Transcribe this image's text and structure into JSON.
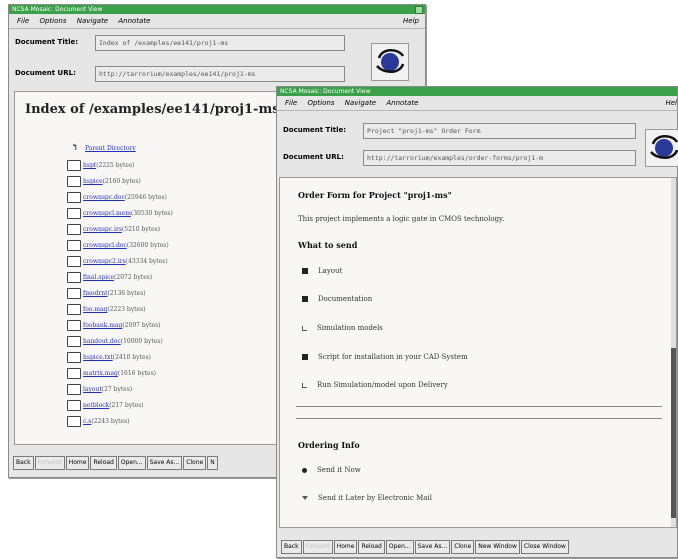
{
  "win1": {
    "title": "NCSA Mosaic: Document View",
    "menu": [
      "File",
      "Options",
      "Navigate",
      "Annotate"
    ],
    "help": "Help",
    "doc_title_label": "Document Title:",
    "doc_title_value": "Index of /examples/ee141/proj1-ms",
    "doc_url_label": "Document URL:",
    "doc_url_value": "http://tarrorium/examples/ee141/proj1-ms",
    "page_heading": "Index of /examples/ee141/proj1-ms",
    "files": [
      {
        "name": "Parent Directory",
        "size": ""
      },
      {
        "name": "hspt",
        "size": "(2225 bytes)"
      },
      {
        "name": "hspice",
        "size": "(2160 bytes)"
      },
      {
        "name": "crownspc.doc",
        "size": "(25946 bytes)"
      },
      {
        "name": "crownspcl.mem",
        "size": "(30530 bytes)"
      },
      {
        "name": "crownspc.irs",
        "size": "(5210 bytes)"
      },
      {
        "name": "crownspcl.doc",
        "size": "(32600 bytes)"
      },
      {
        "name": "crownspc2.irs",
        "size": "(43334 bytes)"
      },
      {
        "name": "final.spice",
        "size": "(2072 bytes)"
      },
      {
        "name": "fmodrnt",
        "size": "(2136 bytes)"
      },
      {
        "name": "foo.mag",
        "size": "(2223 bytes)"
      },
      {
        "name": "foobank.mag",
        "size": "(2097 bytes)"
      },
      {
        "name": "handout.doc",
        "size": "(10000 bytes)"
      },
      {
        "name": "hspice.txt",
        "size": "(2410 bytes)"
      },
      {
        "name": "matrix.mag",
        "size": "(1616 bytes)"
      },
      {
        "name": "layout",
        "size": "(27 bytes)"
      },
      {
        "name": "netblock",
        "size": "(217 bytes)"
      },
      {
        "name": "c.s",
        "size": "(2243 bytes)"
      }
    ],
    "buttons": [
      "Back",
      "Forward",
      "Home",
      "Reload",
      "Open...",
      "Save As...",
      "Clone",
      "N"
    ]
  },
  "win2": {
    "title": "NCSA Mosaic: Document View",
    "menu": [
      "File",
      "Options",
      "Navigate",
      "Annotate"
    ],
    "help": "Hel",
    "doc_title_label": "Document Title:",
    "doc_title_value": "Project \"proj1-ms\" Order Form",
    "doc_url_label": "Document URL:",
    "doc_url_value": "http://tarrorium/examples/order-forms/proj1-m",
    "form_heading": "Order Form for Project \"proj1-ms\"",
    "intro": "This project implements a logic gate in CMOS technology.",
    "what_heading": "What to send",
    "items": [
      {
        "label": "Layout",
        "checked": true
      },
      {
        "label": "Documentation",
        "checked": true
      },
      {
        "label": "Simulation models",
        "checked": false
      },
      {
        "label": "Script for installation in your CAD System",
        "checked": true
      },
      {
        "label": "Run Simulation/model upon Delivery",
        "checked": false
      }
    ],
    "ordering_heading": "Ordering Info",
    "ordering_options": [
      {
        "label": "Send it Now",
        "selected": true
      },
      {
        "label": "Send it Later by Electronic Mail",
        "selected": false
      }
    ],
    "buttons": [
      "Back",
      "Forward",
      "Home",
      "Reload",
      "Open...",
      "Save As...",
      "Clone",
      "New Window",
      "Close Window"
    ]
  },
  "colors": {
    "titlebar": "#3aa04a",
    "link": "#2233bb",
    "content_bg": "#f9f6f6"
  },
  "icons": [
    "mosaic-globe-icon",
    "folder-up-icon",
    "document-icon",
    "checkbox-icon",
    "radio-icon"
  ]
}
